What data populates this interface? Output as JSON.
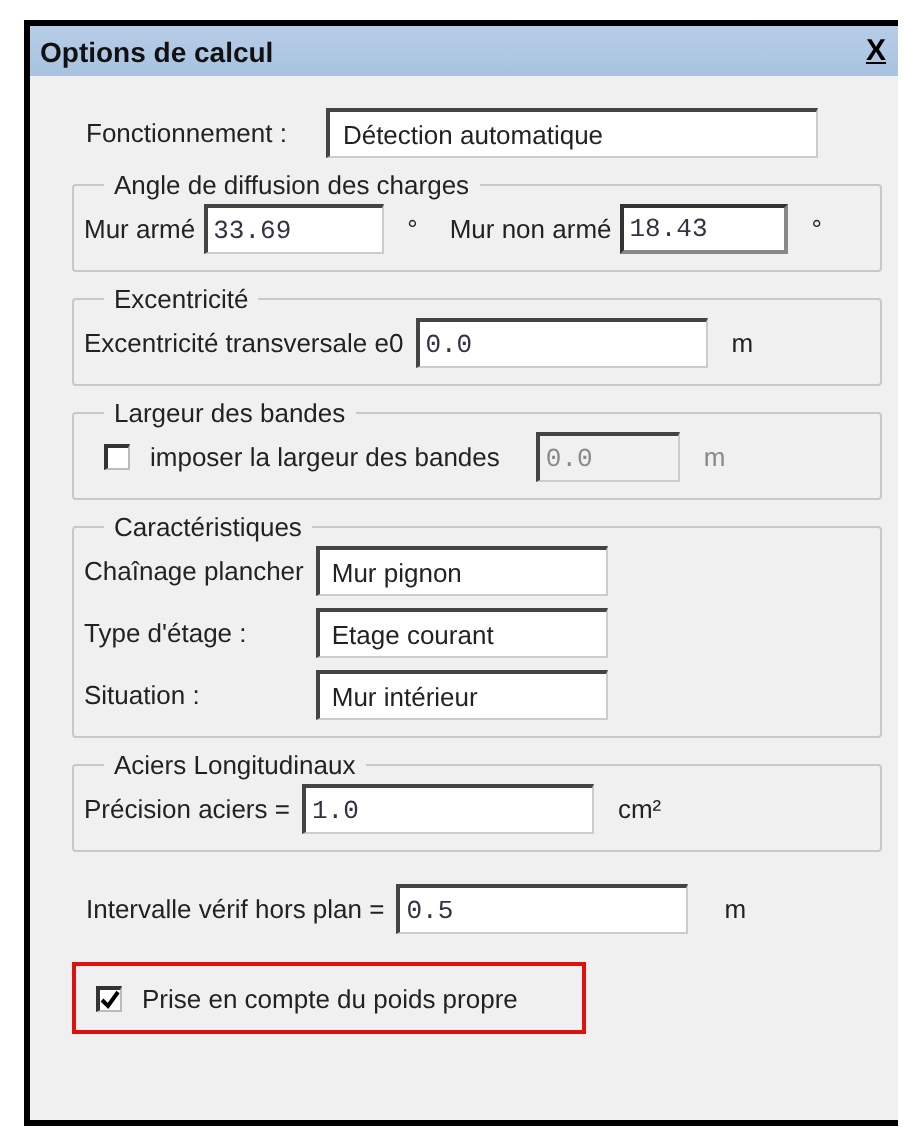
{
  "window": {
    "title": "Options de calcul",
    "close": "X"
  },
  "sections": [
    {
      "kind": "wide-row",
      "label": "Fonctionnement :",
      "value": "Détection automatique"
    },
    {
      "kind": "inline-group",
      "title": "Angle de diffusion des charges",
      "fields": [
        {
          "kind": "number",
          "label": "Mur armé",
          "value": "33.69",
          "unit": "°",
          "focused": false
        },
        {
          "kind": "number",
          "label": "Mur non armé",
          "value": "18.43",
          "unit": "°",
          "focused": true
        }
      ]
    },
    {
      "kind": "group",
      "title": "Excentricité",
      "fields": [
        {
          "kind": "number",
          "label": "Excentricité transversale e0",
          "value": "0.0",
          "unit": "m",
          "focused": false
        }
      ]
    },
    {
      "kind": "group",
      "title": "Largeur des bandes",
      "fields": [
        {
          "kind": "checkbox",
          "label": "imposer la largeur des bandes",
          "checked": false,
          "value": "0.0",
          "unit": "m",
          "disabled": true
        }
      ]
    },
    {
      "kind": "group",
      "title": "Caractéristiques",
      "fields": [
        {
          "kind": "text",
          "label": "Chaînage plancher",
          "value": "Mur pignon",
          "focused": false
        },
        {
          "kind": "text",
          "label": "Type d'étage :",
          "value": "Etage courant",
          "focused": false
        },
        {
          "kind": "text",
          "label": "Situation :",
          "value": "Mur intérieur",
          "focused": false
        }
      ]
    },
    {
      "kind": "group",
      "title": "Aciers Longitudinaux",
      "fields": [
        {
          "kind": "number",
          "label": "Précision aciers =",
          "value": "1.0",
          "unit": "cm²",
          "focused": false
        }
      ]
    },
    {
      "kind": "row",
      "label": "Intervalle vérif hors plan =",
      "value": "0.5",
      "unit": "m"
    },
    {
      "kind": "check",
      "label": "Prise en compte du poids propre",
      "checked": true,
      "highlighted": true
    }
  ]
}
